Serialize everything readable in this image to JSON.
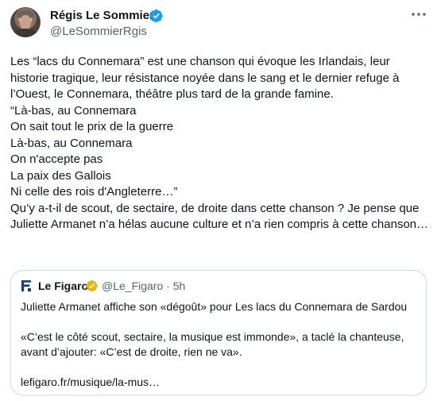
{
  "author": {
    "name": "Régis Le Sommier",
    "handle": "@LeSommierRgis",
    "verified": true
  },
  "tweet_text": "Les “lacs du Connemara” est une chanson qui évoque les Irlandais, leur historie tragique, leur résistance noyée dans le sang et le dernier refuge à l’Ouest, le Connemara, théâtre plus tard de la grande famine.\n“Là-bas, au Connemara\nOn sait tout le prix de la guerre\nLà-bas, au Connemara\nOn n'accepte pas\nLa paix des Gallois\nNi celle des rois d'Angleterre…”\nQu’y a-t-il de scout, de sectaire, de droite dans cette chanson ? Je pense que Juliette Armanet n’a hélas aucune culture et n’a rien compris à cette chanson…",
  "quoted": {
    "name": "Le Figaro",
    "handle_time": "@Le_Figaro · 5h",
    "badge_color": "#e2b719",
    "text": "Juliette Armanet affiche son «dégoût» pour Les lacs du Connemara de Sardou\n\n«C’est le côté scout, sectaire, la musique est immonde», a taclé la chanteuse, avant d’ajouter: «C’est de droite, rien ne va».\n\nlefigaro.fr/musique/la-mus…"
  },
  "colors": {
    "verified_blue": "#1d9bf0",
    "secondary_text": "#536471",
    "border": "#cfd9de"
  }
}
